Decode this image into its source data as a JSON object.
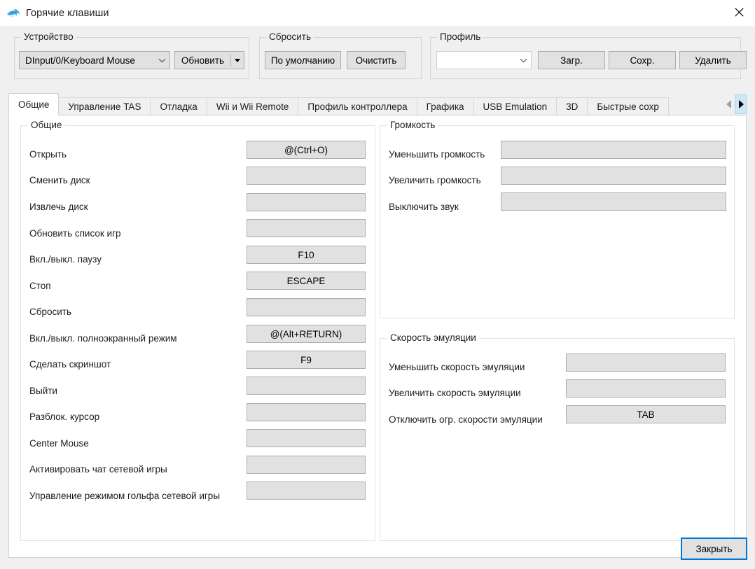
{
  "window": {
    "title": "Горячие клавиши",
    "app_icon": "dolphin-icon",
    "close_icon": "close-icon"
  },
  "toolbar": {
    "device_group": {
      "title": "Устройство",
      "combo_value": "DInput/0/Keyboard Mouse",
      "refresh_label": "Обновить"
    },
    "reset_group": {
      "title": "Сбросить",
      "default_label": "По умолчанию",
      "clear_label": "Очистить"
    },
    "profile_group": {
      "title": "Профиль",
      "combo_value": "",
      "load_label": "Загр.",
      "save_label": "Сохр.",
      "delete_label": "Удалить"
    }
  },
  "tabs": {
    "items": [
      {
        "label": "Общие",
        "active": true
      },
      {
        "label": "Управление TAS",
        "active": false
      },
      {
        "label": "Отладка",
        "active": false
      },
      {
        "label": "Wii и Wii Remote",
        "active": false
      },
      {
        "label": "Профиль контроллера",
        "active": false
      },
      {
        "label": "Графика",
        "active": false
      },
      {
        "label": "USB Emulation",
        "active": false
      },
      {
        "label": "3D",
        "active": false
      },
      {
        "label": "Быстрые сохр",
        "active": false
      }
    ],
    "scroll_left_icon": "triangle-left-icon",
    "scroll_right_icon": "triangle-right-icon"
  },
  "panels": {
    "general": {
      "title": "Общие",
      "rows": [
        {
          "label": "Открыть",
          "value": "@(Ctrl+O)"
        },
        {
          "label": "Сменить диск",
          "value": ""
        },
        {
          "label": "Извлечь диск",
          "value": ""
        },
        {
          "label": "Обновить список игр",
          "value": ""
        },
        {
          "label": "Вкл./выкл. паузу",
          "value": "F10"
        },
        {
          "label": "Стоп",
          "value": "ESCAPE"
        },
        {
          "label": "Сбросить",
          "value": ""
        },
        {
          "label": "Вкл./выкл. полноэкранный режим",
          "value": "@(Alt+RETURN)"
        },
        {
          "label": "Сделать скриншот",
          "value": "F9"
        },
        {
          "label": "Выйти",
          "value": ""
        },
        {
          "label": "Разблок. курсор",
          "value": ""
        },
        {
          "label": "Center Mouse",
          "value": ""
        },
        {
          "label": "Активировать чат сетевой игры",
          "value": ""
        },
        {
          "label": "Управление режимом гольфа сетевой игры",
          "value": ""
        }
      ]
    },
    "volume": {
      "title": "Громкость",
      "rows": [
        {
          "label": "Уменьшить громкость",
          "value": ""
        },
        {
          "label": "Увеличить громкость",
          "value": ""
        },
        {
          "label": "Выключить звук",
          "value": ""
        }
      ]
    },
    "emulation_speed": {
      "title": "Скорость эмуляции",
      "rows": [
        {
          "label": "Уменьшить скорость эмуляции",
          "value": ""
        },
        {
          "label": "Увеличить скорость эмуляции",
          "value": ""
        },
        {
          "label": "Отключить огр. скорости эмуляции",
          "value": "TAB"
        }
      ]
    }
  },
  "footer": {
    "close_label": "Закрыть"
  },
  "colors": {
    "window_bg": "#f0f0f0",
    "content_bg": "#ffffff",
    "button_face": "#e1e1e1",
    "button_border": "#adadad",
    "focus_blue": "#0078d7",
    "tab_hover": "#cce8f7",
    "dolphin_blue": "#2e9bd6"
  }
}
